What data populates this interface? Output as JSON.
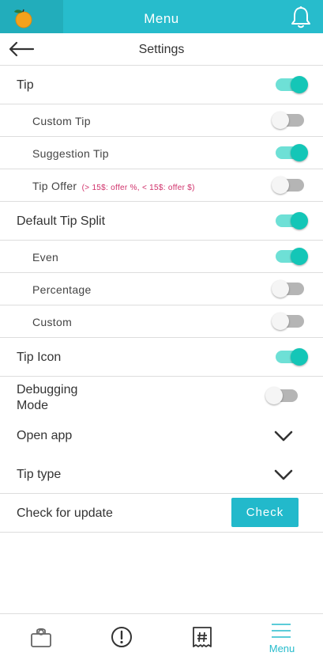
{
  "header": {
    "title": "Menu"
  },
  "subheader": {
    "title": "Settings"
  },
  "rows": {
    "tip": {
      "label": "Tip",
      "on": true
    },
    "custom_tip": {
      "label": "Custom Tip",
      "on": false
    },
    "suggestion_tip": {
      "label": "Suggestion Tip",
      "on": true
    },
    "tip_offer": {
      "label": "Tip Offer",
      "note": "(> 15$: offer %,  < 15$: offer $)",
      "on": false
    },
    "default_tip_split": {
      "label": "Default Tip Split",
      "on": true
    },
    "even": {
      "label": "Even",
      "on": true
    },
    "percentage": {
      "label": "Percentage",
      "on": false
    },
    "custom": {
      "label": "Custom",
      "on": false
    },
    "tip_icon": {
      "label": "Tip Icon",
      "on": true
    },
    "debugging": {
      "label_line1": "Debugging",
      "label_line2": "Mode",
      "on": false
    },
    "open_app": {
      "label": "Open app"
    },
    "tip_type": {
      "label": "Tip type"
    },
    "check_update": {
      "label": "Check for update",
      "button": "Check"
    }
  },
  "bottom_nav": {
    "items": [
      {
        "icon": "clipboard-icon"
      },
      {
        "icon": "alert-icon"
      },
      {
        "icon": "receipt-hash-icon"
      },
      {
        "icon": "menu-icon",
        "label": "Menu",
        "active": true
      }
    ]
  },
  "colors": {
    "accent": "#27bccc",
    "toggle_on": "#14c6b7",
    "note": "#d0306a"
  }
}
